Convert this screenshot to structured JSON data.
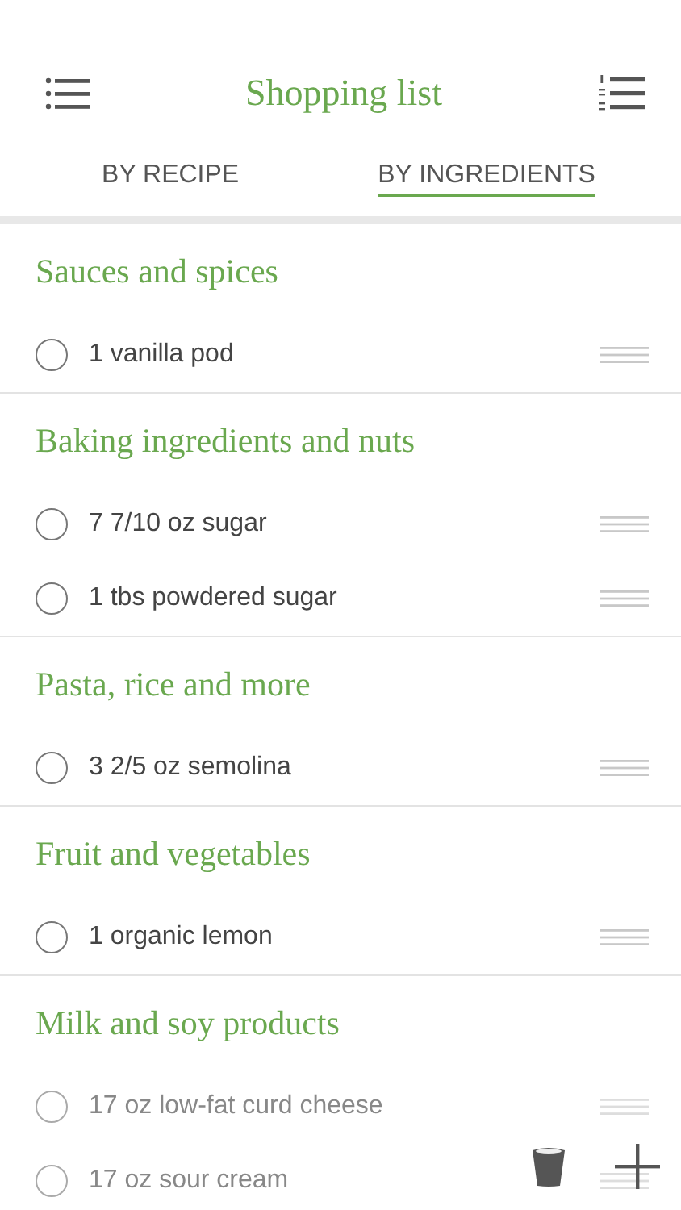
{
  "header": {
    "title": "Shopping list"
  },
  "tabs": [
    {
      "label": "BY RECIPE",
      "selected": false
    },
    {
      "label": "BY INGREDIENTS",
      "selected": true
    }
  ],
  "sections": [
    {
      "title": "Sauces and spices",
      "items": [
        {
          "text": "1 vanilla pod",
          "checked": false
        }
      ]
    },
    {
      "title": "Baking ingredients and nuts",
      "items": [
        {
          "text": "7 7/10 oz sugar",
          "checked": false
        },
        {
          "text": "1 tbs powdered sugar",
          "checked": false
        }
      ]
    },
    {
      "title": "Pasta, rice and more",
      "items": [
        {
          "text": "3 2/5 oz semolina",
          "checked": false
        }
      ]
    },
    {
      "title": "Fruit and vegetables",
      "items": [
        {
          "text": "1 organic lemon",
          "checked": false
        }
      ]
    },
    {
      "title": "Milk and soy products",
      "items": [
        {
          "text": "17 oz low-fat curd cheese",
          "checked": false
        },
        {
          "text": "17 oz sour cream",
          "checked": false
        }
      ]
    }
  ]
}
